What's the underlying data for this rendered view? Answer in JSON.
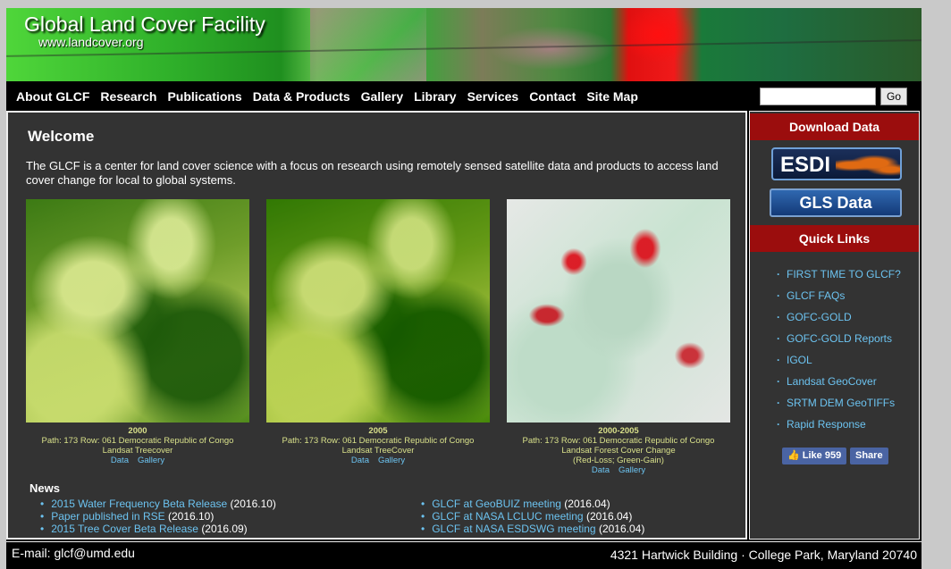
{
  "site": {
    "title": "Global Land Cover Facility",
    "url": "www.landcover.org"
  },
  "nav": {
    "items": [
      "About GLCF",
      "Research",
      "Publications",
      "Data & Products",
      "Gallery",
      "Library",
      "Services",
      "Contact",
      "Site Map"
    ],
    "search_value": "",
    "search_button": "Go"
  },
  "main": {
    "welcome_title": "Welcome",
    "intro": "The GLCF is a center for land cover science with a focus on research using remotely sensed satellite data and products to access land cover change for local to global systems.",
    "figures": [
      {
        "year": "2000",
        "location": "Path: 173  Row: 061  Democratic Republic of Congo",
        "product": "Landsat Treecover",
        "legend": "",
        "link_data": "Data",
        "link_gallery": "Gallery"
      },
      {
        "year": "2005",
        "location": "Path: 173  Row: 061  Democratic Republic of Congo",
        "product": "Landsat TreeCover",
        "legend": "",
        "link_data": "Data",
        "link_gallery": "Gallery"
      },
      {
        "year": "2000-2005",
        "location": "Path: 173  Row: 061  Democratic Republic of Congo",
        "product": "Landsat Forest Cover Change",
        "legend": "(Red-Loss; Green-Gain)",
        "link_data": "Data",
        "link_gallery": "Gallery"
      }
    ],
    "news_title": "News",
    "news_left": [
      {
        "title": "2015 Water Frequency Beta Release",
        "date": "(2016.10)"
      },
      {
        "title": "Paper published in RSE",
        "date": "(2016.10)"
      },
      {
        "title": "2015 Tree Cover Beta Release",
        "date": "(2016.09)"
      }
    ],
    "news_right": [
      {
        "title": "GLCF at GeoBUIZ meeting",
        "date": "(2016.04)"
      },
      {
        "title": "GLCF at NASA LCLUC meeting",
        "date": "(2016.04)"
      },
      {
        "title": "GLCF at NASA ESDSWG meeting",
        "date": "(2016.04)"
      }
    ]
  },
  "sidebar": {
    "download_title": "Download Data",
    "esdi_label": "ESDI",
    "gls_label": "GLS Data",
    "quick_links_title": "Quick Links",
    "quick_links": [
      "FIRST TIME TO GLCF?",
      "GLCF FAQs",
      "GOFC-GOLD",
      "GOFC-GOLD Reports",
      "IGOL",
      "Landsat GeoCover",
      "SRTM DEM GeoTIFFs",
      "Rapid Response"
    ],
    "like_label": "Like 959",
    "share_label": "Share"
  },
  "footer": {
    "email": "E-mail: glcf@umd.edu",
    "address": "4321 Hartwick Building · College Park, Maryland 20740"
  },
  "colors": {
    "accent_red": "#9b0d0d",
    "link_blue": "#6cc3f0",
    "caption_yellow": "#d8e08a",
    "panel_bg": "#333333"
  }
}
